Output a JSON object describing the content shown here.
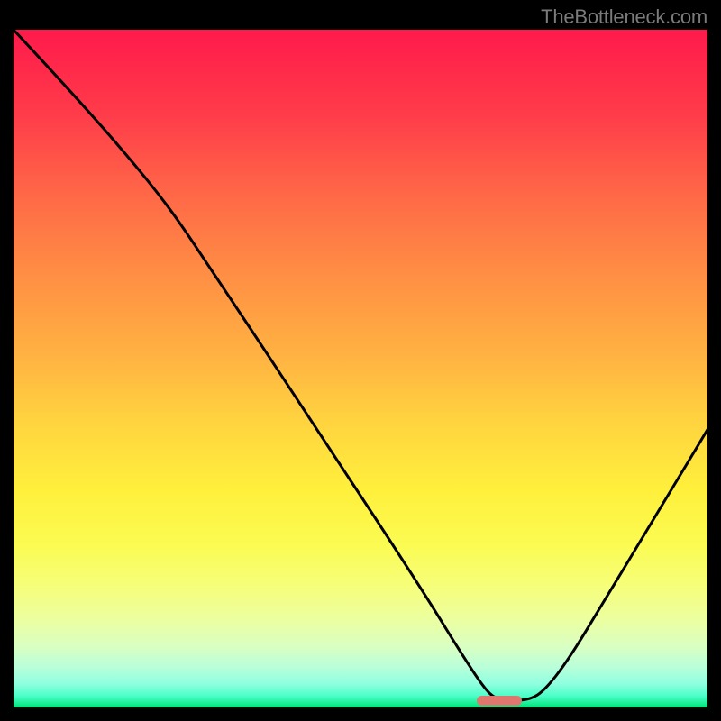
{
  "attribution": "TheBottleneck.com",
  "marker": {
    "color": "#e0776f",
    "x_pct": 70,
    "y_pct": 99,
    "width_pct": 6.5,
    "height_pct": 1.4
  },
  "chart_data": {
    "type": "line",
    "title": "",
    "xlabel": "",
    "ylabel": "",
    "xlim_pct": [
      0,
      100
    ],
    "ylim_pct": [
      0,
      100
    ],
    "axes_visible": false,
    "grid": false,
    "background": "rainbow-vertical-red-to-green",
    "series": [
      {
        "name": "bottleneck-curve",
        "stroke": "#000000",
        "points_pct": [
          {
            "x": 0.0,
            "y": 0.0
          },
          {
            "x": 7.5,
            "y": 8.3
          },
          {
            "x": 14.5,
            "y": 16.3
          },
          {
            "x": 20.2,
            "y": 23.3
          },
          {
            "x": 24.0,
            "y": 28.5
          },
          {
            "x": 29.0,
            "y": 36.2
          },
          {
            "x": 37.0,
            "y": 48.5
          },
          {
            "x": 45.0,
            "y": 61.0
          },
          {
            "x": 53.2,
            "y": 73.7
          },
          {
            "x": 60.0,
            "y": 84.5
          },
          {
            "x": 64.5,
            "y": 92.0
          },
          {
            "x": 67.7,
            "y": 97.0
          },
          {
            "x": 69.5,
            "y": 98.8
          },
          {
            "x": 72.0,
            "y": 99.0
          },
          {
            "x": 74.5,
            "y": 98.8
          },
          {
            "x": 76.5,
            "y": 97.5
          },
          {
            "x": 79.8,
            "y": 93.2
          },
          {
            "x": 85.0,
            "y": 84.5
          },
          {
            "x": 91.0,
            "y": 74.3
          },
          {
            "x": 96.2,
            "y": 65.5
          },
          {
            "x": 100.0,
            "y": 59.0
          }
        ]
      }
    ],
    "optimum_marker_x_pct": 72.0,
    "note": "Percent coordinates along plot area: x=0 left edge, x=100 right edge; y=0 top, y=100 bottom. Curve depicts bottleneck severity (red high, green low) with minimum near x≈72%."
  }
}
